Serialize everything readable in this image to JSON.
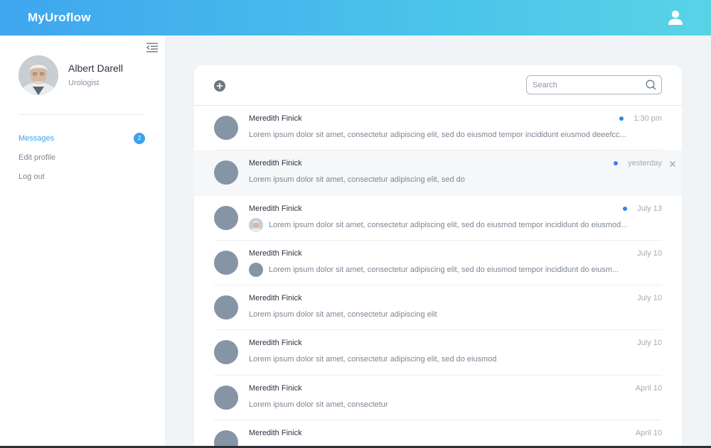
{
  "app": {
    "title": "MyUroflow"
  },
  "profile": {
    "name": "Albert Darell",
    "role": "Urologist"
  },
  "nav": [
    {
      "label": "Messages",
      "active": true,
      "badge": "2"
    },
    {
      "label": "Edit profile",
      "active": false
    },
    {
      "label": "Log out",
      "active": false
    }
  ],
  "search": {
    "placeholder": "Search",
    "value": ""
  },
  "messages": [
    {
      "sender": "Meredith Finick",
      "preview": "Lorem ipsum dolor sit amet, consectetur adipiscing elit, sed do eiusmod tempor incididunt eiusmod deeefcc...",
      "time": "1:30 pm",
      "unread": true,
      "mini_avatar": "none",
      "hover": false
    },
    {
      "sender": "Meredith Finick",
      "preview": "Lorem ipsum dolor sit amet, consectetur adipiscing elit, sed do",
      "time": "yesterday",
      "unread": true,
      "mini_avatar": "none",
      "hover": true
    },
    {
      "sender": "Meredith Finick",
      "preview": "Lorem ipsum dolor sit amet, consectetur adipiscing elit, sed do eiusmod tempor incididunt do eiusmod...",
      "time": "July 13",
      "unread": true,
      "mini_avatar": "photo",
      "hover": false
    },
    {
      "sender": "Meredith Finick",
      "preview": "Lorem ipsum dolor sit amet, consectetur adipiscing elit, sed do eiusmod tempor incididunt do eiusm...",
      "time": "July 10",
      "unread": false,
      "mini_avatar": "placeholder",
      "hover": false
    },
    {
      "sender": "Meredith Finick",
      "preview": "Lorem ipsum dolor sit amet, consectetur adipiscing elit",
      "time": "July 10",
      "unread": false,
      "mini_avatar": "none",
      "hover": false
    },
    {
      "sender": "Meredith Finick",
      "preview": "Lorem ipsum dolor sit amet, consectetur adipiscing elit, sed do eiusmod",
      "time": "July 10",
      "unread": false,
      "mini_avatar": "none",
      "hover": false
    },
    {
      "sender": "Meredith Finick",
      "preview": "Lorem ipsum dolor sit amet, consectetur",
      "time": "April 10",
      "unread": false,
      "mini_avatar": "none",
      "hover": false
    },
    {
      "sender": "Meredith Finick",
      "preview": "",
      "time": "April 10",
      "unread": false,
      "mini_avatar": "none",
      "hover": false
    }
  ],
  "colors": {
    "accent": "#3aa3ec",
    "unread_dot": "#2f86ea",
    "avatar_placeholder": "#8595a6"
  }
}
